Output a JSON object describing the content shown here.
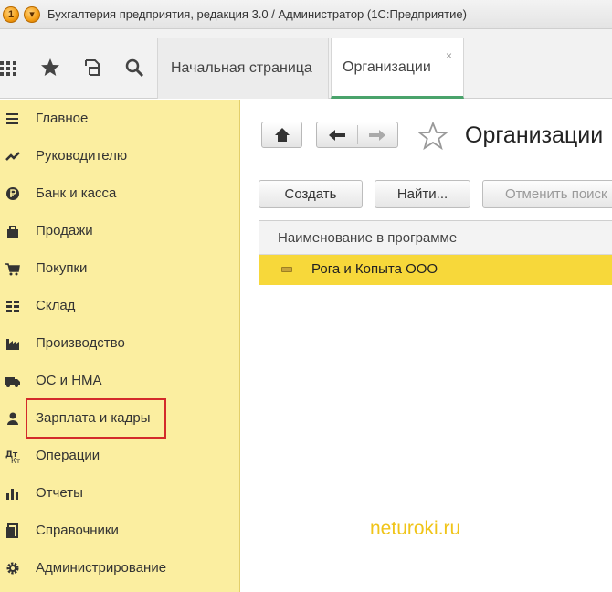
{
  "window": {
    "title": "Бухгалтерия предприятия, редакция 3.0 / Администратор  (1С:Предприятие)"
  },
  "toolbar": {
    "icons": [
      "apps-grid-icon",
      "favorites-star-icon",
      "history-icon",
      "search-icon"
    ]
  },
  "tabs": [
    {
      "label": "Начальная страница",
      "active": false
    },
    {
      "label": "Организации",
      "active": true,
      "close": "×"
    }
  ],
  "sidebar": {
    "items": [
      {
        "label": "Главное",
        "icon": "menu-lines-icon"
      },
      {
        "label": "Руководителю",
        "icon": "trend-icon"
      },
      {
        "label": "Банк и касса",
        "icon": "ruble-coin-icon"
      },
      {
        "label": "Продажи",
        "icon": "shopping-bag-icon"
      },
      {
        "label": "Покупки",
        "icon": "cart-icon"
      },
      {
        "label": "Склад",
        "icon": "warehouse-icon"
      },
      {
        "label": "Производство",
        "icon": "factory-icon"
      },
      {
        "label": "ОС и НМА",
        "icon": "truck-icon"
      },
      {
        "label": "Зарплата и кадры",
        "icon": "person-icon",
        "highlighted": true
      },
      {
        "label": "Операции",
        "icon": "operations-icon"
      },
      {
        "label": "Отчеты",
        "icon": "bar-chart-icon"
      },
      {
        "label": "Справочники",
        "icon": "books-icon"
      },
      {
        "label": "Администрирование",
        "icon": "gear-icon"
      }
    ],
    "highlight_color": "#d32a2a",
    "background": "#fbeea0"
  },
  "main": {
    "title": "Организации",
    "buttons": {
      "create": "Создать",
      "find": "Найти...",
      "cancel_search": "Отменить поиск"
    },
    "table": {
      "column": "Наименование в программе",
      "rows": [
        {
          "name": "Рога и Копыта ООО",
          "selected": true
        }
      ],
      "selected_color": "#f7d83a"
    },
    "watermark": "neturoki.ru"
  },
  "colors": {
    "active_tab_underline": "#4aa36b",
    "watermark": "#f0c419"
  }
}
